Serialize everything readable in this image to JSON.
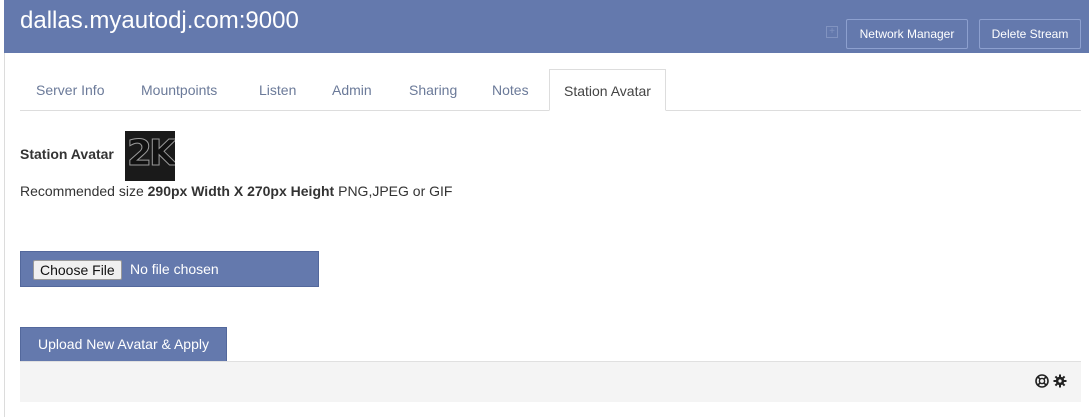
{
  "header": {
    "title": "dallas.myautodj.com:9000",
    "network_manager_label": "Network Manager",
    "delete_stream_label": "Delete Stream"
  },
  "tabs": [
    {
      "label": "Server Info"
    },
    {
      "label": "Mountpoints"
    },
    {
      "label": "Listen"
    },
    {
      "label": "Admin"
    },
    {
      "label": "Sharing"
    },
    {
      "label": "Notes"
    },
    {
      "label": "Station Avatar",
      "active": true
    }
  ],
  "avatar_section": {
    "label": "Station Avatar",
    "image_text": "2K",
    "rec_prefix": "Recommended size ",
    "rec_size": "290px Width X 270px Height",
    "rec_suffix": " PNG,JPEG or GIF"
  },
  "file_input": {
    "button_label": "Choose File",
    "status": "No file chosen"
  },
  "upload_label": "Upload New Avatar & Apply",
  "footer_icons": [
    "lifebuoy-icon",
    "gear-icon"
  ],
  "colors": {
    "accent": "#6479ad",
    "tab_text": "#6b7a99"
  }
}
